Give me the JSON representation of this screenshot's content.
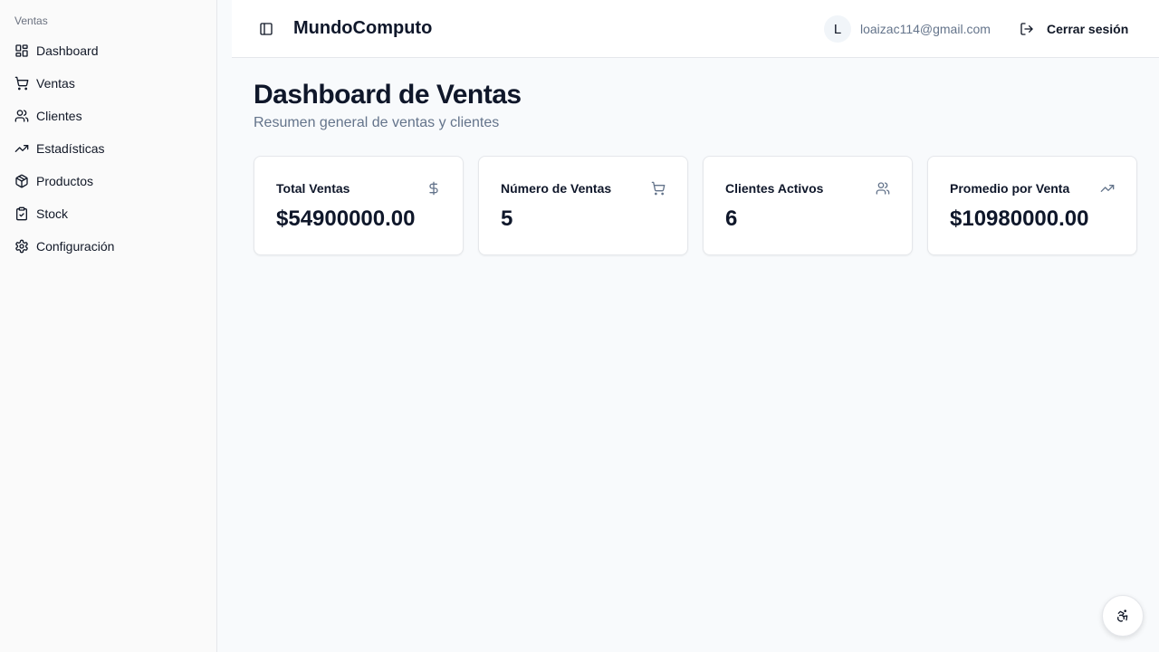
{
  "sidebar": {
    "group_label": "Ventas",
    "items": [
      {
        "label": "Dashboard",
        "icon": "dashboard-icon"
      },
      {
        "label": "Ventas",
        "icon": "cart-icon"
      },
      {
        "label": "Clientes",
        "icon": "users-icon"
      },
      {
        "label": "Estadísticas",
        "icon": "trending-up-icon"
      },
      {
        "label": "Productos",
        "icon": "package-icon"
      },
      {
        "label": "Stock",
        "icon": "clipboard-check-icon"
      },
      {
        "label": "Configuración",
        "icon": "gear-icon"
      }
    ]
  },
  "header": {
    "brand": "MundoComputo",
    "avatar_initial": "L",
    "email": "loaizac114@gmail.com",
    "logout_label": "Cerrar sesión"
  },
  "main": {
    "title": "Dashboard de Ventas",
    "subtitle": "Resumen general de ventas y clientes",
    "cards": [
      {
        "title": "Total Ventas",
        "value": "$54900000.00",
        "icon": "dollar-icon"
      },
      {
        "title": "Número de Ventas",
        "value": "5",
        "icon": "cart-icon"
      },
      {
        "title": "Clientes Activos",
        "value": "6",
        "icon": "users-icon"
      },
      {
        "title": "Promedio por Venta",
        "value": "$10980000.00",
        "icon": "trending-up-icon"
      }
    ]
  },
  "colors": {
    "text": "#0f172a",
    "muted": "#64748b",
    "border": "#e5e7eb",
    "background": "#f8fafc"
  }
}
